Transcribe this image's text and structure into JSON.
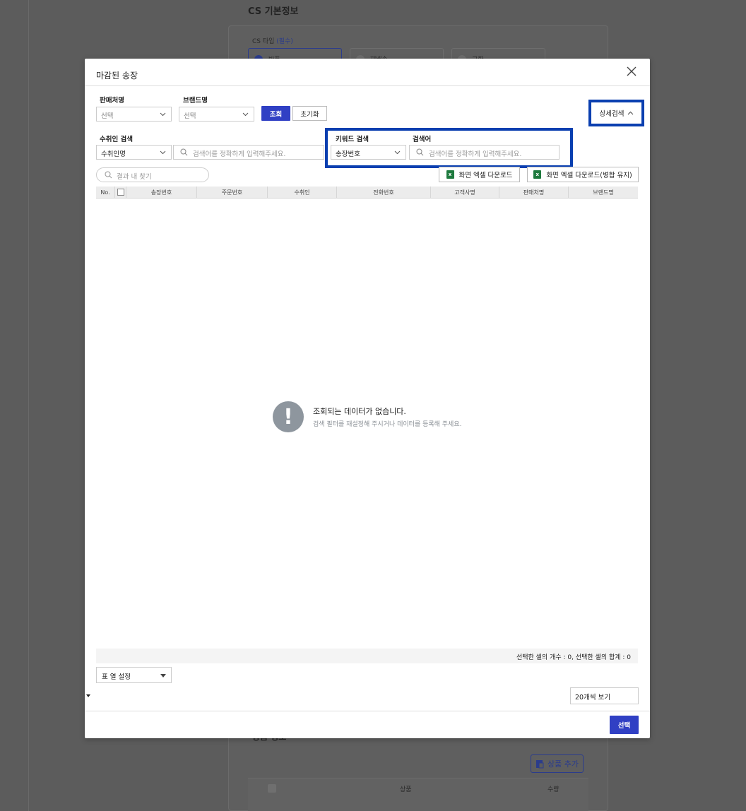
{
  "background": {
    "section_title": "CS 기본정보",
    "cs_type_label": "CS 타입",
    "cs_type_required": "(필수)",
    "cs_type_options": [
      "반품",
      "재배송",
      "교환"
    ],
    "products_section_title": "상품 정보",
    "add_product_label": "상품 추가",
    "products_table_headers": [
      "상품",
      "수량"
    ]
  },
  "modal": {
    "title": "마감된 송장",
    "seller_label": "판매처명",
    "seller_value": "선택",
    "brand_label": "브랜드명",
    "brand_value": "선택",
    "search_button": "조회",
    "reset_button": "초기화",
    "detail_search_button": "상세검색",
    "recipient_search_label": "수취인 검색",
    "recipient_search_type": "수취인명",
    "recipient_search_placeholder": "검색어를 정확하게 입력해주세요.",
    "keyword_search_label": "키워드 검색",
    "keyword_search_type": "송장번호",
    "search_term_label": "검색어",
    "search_term_placeholder": "검색어를 정확하게 입력해주세요.",
    "find_in_results_placeholder": "결과 내 찾기",
    "excel_download_button": "화면 엑셀 다운로드",
    "excel_download_merge_button": "화면 엑셀 다운로드(병합 유지)",
    "columns": [
      "No.",
      "송장번호",
      "주문번호",
      "수취인",
      "전화번호",
      "고객사명",
      "판매처명",
      "브랜드명"
    ],
    "empty_title": "조회되는 데이터가 없습니다.",
    "empty_subtitle": "검색 필터를 재설정해 주시거나 데이터를 등록해 주세요.",
    "selection_summary": "선택한 셀의 개수 : 0, 선택한 셀의 합계 : 0",
    "column_settings": "표 열 설정",
    "page_size": "20개씩 보기",
    "select_button": "선택"
  },
  "colors": {
    "primary": "#3040c4",
    "highlight": "#0a3fb0",
    "excel_green": "#1e7a3e"
  }
}
